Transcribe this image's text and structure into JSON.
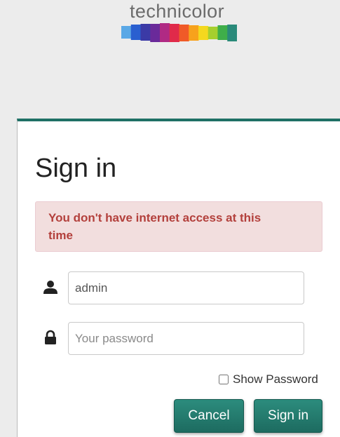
{
  "brand": {
    "name": "technicolor",
    "bar_colors": [
      "#5aa8e6",
      "#2a5fd0",
      "#3b3aa6",
      "#6a2a9a",
      "#b02a84",
      "#e02a4a",
      "#f05a28",
      "#f7a21c",
      "#f4d81e",
      "#a6cf2e",
      "#3fae4a",
      "#2a8a7a"
    ]
  },
  "login": {
    "title": "Sign in",
    "alert_message": "You don't have internet access at this time",
    "username_value": "admin",
    "password_placeholder": "Your password",
    "show_password_label": "Show Password",
    "cancel_label": "Cancel",
    "signin_label": "Sign in"
  },
  "colors": {
    "accent": "#1f7065",
    "alert_bg": "#f2dede",
    "alert_text": "#b3403c"
  }
}
